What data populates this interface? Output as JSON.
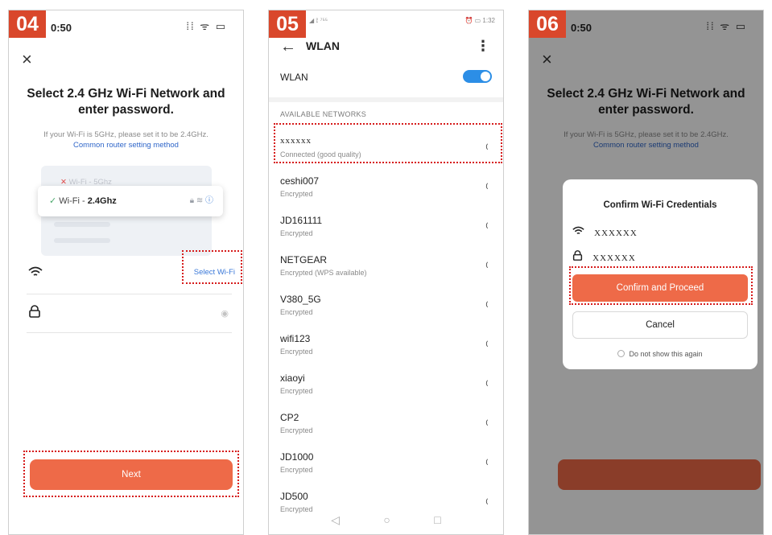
{
  "panel1": {
    "step": "04",
    "time": "0:50",
    "status_icons": "⁞⁞ ᯤ ▭",
    "close_icon": "×",
    "title": "Select 2.4 GHz Wi-Fi Network and enter password.",
    "hint_line": "If your Wi-Fi is 5GHz, please set it to be 2.4GHz.",
    "hint_link": "Common router setting method",
    "illustration": {
      "row_5g": "Wi-Fi - 5Ghz",
      "row_24_prefix": "Wi-Fi - ",
      "row_24_bold": "2.4Ghz"
    },
    "select_wifi": "Select Wi-Fi",
    "next_button": "Next"
  },
  "panel2": {
    "step": "05",
    "status_left": "◢ ⟟ ⁷⁵⁵",
    "status_right": "⏰ ▭ 1:32",
    "title": "WLAN",
    "wlan_label": "WLAN",
    "wlan_on": true,
    "section": "AVAILABLE NETWORKS",
    "networks": [
      {
        "name": "xxxxxx",
        "sub": "Connected (good quality)"
      },
      {
        "name": "ceshi007",
        "sub": "Encrypted"
      },
      {
        "name": "JD161111",
        "sub": "Encrypted"
      },
      {
        "name": "NETGEAR",
        "sub": "Encrypted (WPS available)"
      },
      {
        "name": "V380_5G",
        "sub": "Encrypted"
      },
      {
        "name": "wifi123",
        "sub": "Encrypted"
      },
      {
        "name": "xiaoyi",
        "sub": "Encrypted"
      },
      {
        "name": "CP2",
        "sub": "Encrypted"
      },
      {
        "name": "JD1000",
        "sub": "Encrypted"
      },
      {
        "name": "JD500",
        "sub": "Encrypted"
      }
    ]
  },
  "panel3": {
    "step": "06",
    "time": "0:50",
    "title": "Select 2.4 GHz Wi-Fi Network and enter password.",
    "hint_line": "If your Wi-Fi is 5GHz, please set it to be 2.4GHz.",
    "hint_link": "Common router setting method",
    "dialog": {
      "title": "Confirm Wi-Fi Credentials",
      "ssid": "XXXXXX",
      "password": "XXXXXX",
      "confirm": "Confirm and Proceed",
      "cancel": "Cancel",
      "dont_show": "Do not show this again"
    }
  },
  "colors": {
    "step_badge": "#d9472b",
    "primary_button": "#ee6a48",
    "link": "#2f66c9",
    "highlight_dots": "#d61b1b",
    "toggle_on": "#2c8ee6"
  }
}
